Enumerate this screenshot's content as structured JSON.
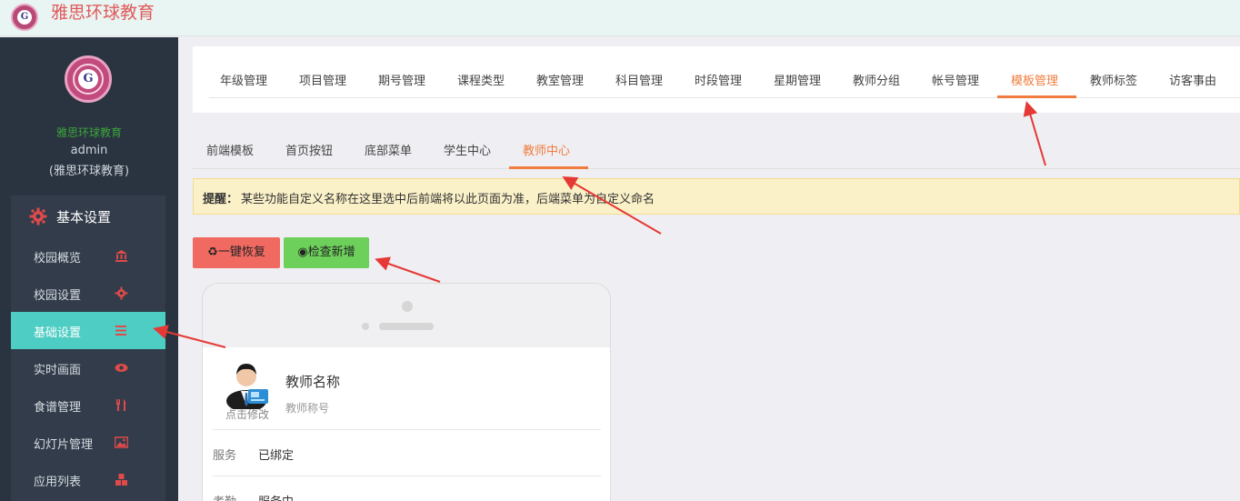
{
  "header": {
    "title": "雅思环球教育",
    "logo_letter": "G"
  },
  "sidebar": {
    "org": "雅思环球教育",
    "user": "admin",
    "sub": "(雅思环球教育)",
    "section_title": "基本设置",
    "items": [
      {
        "label": "校园概览",
        "icon": "bank-icon"
      },
      {
        "label": "校园设置",
        "icon": "gear-icon"
      },
      {
        "label": "基础设置",
        "icon": "list-icon",
        "active": true
      },
      {
        "label": "实时画面",
        "icon": "eye-icon"
      },
      {
        "label": "食谱管理",
        "icon": "cutlery-icon"
      },
      {
        "label": "幻灯片管理",
        "icon": "image-icon"
      },
      {
        "label": "应用列表",
        "icon": "cubes-icon"
      }
    ]
  },
  "tabs": [
    "年级管理",
    "项目管理",
    "期号管理",
    "课程类型",
    "教室管理",
    "科目管理",
    "时段管理",
    "星期管理",
    "教师分组",
    "帐号管理",
    "模板管理",
    "教师标签",
    "访客事由"
  ],
  "active_tab": "模板管理",
  "subtabs": [
    "前端模板",
    "首页按钮",
    "底部菜单",
    "学生中心",
    "教师中心"
  ],
  "active_subtab": "教师中心",
  "notice": {
    "bold": "提醒：",
    "text": "某些功能自定义名称在这里选中后前端将以此页面为准，后端菜单为自定义命名"
  },
  "buttons": {
    "restore": "♻一键恢复",
    "check": "◉检查新增"
  },
  "preview": {
    "teacher_name": "教师名称",
    "teacher_title": "教师称号",
    "avatar_tip": "点击修改",
    "rows": [
      {
        "key": "服务",
        "value": "已绑定"
      },
      {
        "key": "考勤",
        "value": "服务中"
      }
    ]
  },
  "colors": {
    "accent": "#f07c3f",
    "sidebar": "#2a3441",
    "active_menu": "#4ecdc4",
    "arrow": "#e53935"
  }
}
